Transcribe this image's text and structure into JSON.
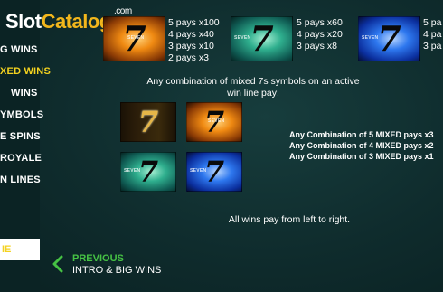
{
  "logo": {
    "part1": "Slot",
    "part2": "Catalog",
    "suffix": ".com"
  },
  "sidebar": {
    "items": [
      {
        "label": "G WINS",
        "active": false
      },
      {
        "label": "XED WINS",
        "active": true
      },
      {
        "label": "WINS",
        "active": false
      },
      {
        "label": "YMBOLS",
        "active": false
      },
      {
        "label": "E SPINS",
        "active": false
      },
      {
        "label": "ROYALE",
        "active": false
      },
      {
        "label": "N LINES",
        "active": false
      }
    ],
    "bottom_button": "IE"
  },
  "symbols": {
    "orange": {
      "pays": [
        "5 pays x100",
        "4 pays x40",
        "3 pays x10",
        "2 pays x3"
      ]
    },
    "green": {
      "pays": [
        "5 pays x60",
        "4 pays x20",
        "3 pays x8"
      ]
    },
    "blue": {
      "pays": [
        "5 pa",
        "4 pa",
        "3 pa"
      ]
    },
    "tile_tag": "SEVEN"
  },
  "mixed_note": "Any combination of mixed 7s symbols on an active win line pay:",
  "mixed_pays": [
    "Any Combination of 5 MIXED pays x3",
    "Any Combination of 4 MIXED pays x2",
    "Any Combination of 3 MIXED pays x1"
  ],
  "all_wins_note": "All wins pay from left to right.",
  "footer": {
    "prev_label": "PREVIOUS",
    "prev_target": "INTRO & BIG WINS"
  },
  "colors": {
    "accent_yellow": "#f4d21f",
    "nav_green": "#46c244",
    "background": "#0e2a2b"
  },
  "icons": {
    "previous": "chevron-left-icon",
    "seven_symbol": "seven-icon"
  }
}
